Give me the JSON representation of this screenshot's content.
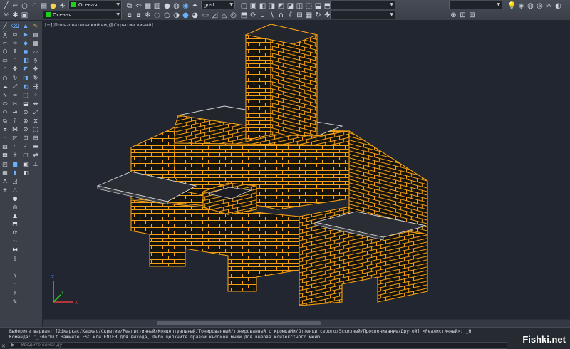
{
  "toolbar": {
    "layer_name": "Осевая",
    "style_name": "gost",
    "layer_color": "#19d319"
  },
  "viewport": {
    "label": "[−][Пользовательский вид][Скрытие линий]",
    "background": "#212630",
    "model_color": "#f5a014",
    "slab_color": "#d6d6d6"
  },
  "ucs": {
    "x_label": "X",
    "y_label": "Y",
    "z_label": "Z"
  },
  "command": {
    "line1": "Выберите вариант [2dкаркас/Каркас/Скрытие/Реалистичный/Концептуальный/Тонированный/тонированный с кромкаМи/Оттенки серого/Эскизный/Просвечивание/Другой] <Реалистичный>: _H",
    "line2": "Команда: '_3dorbit Нажмите ESC или ENTER для выхода, либо щелкните правой кнопкой мыши для вызова контекстного меню.",
    "placeholder": "Введите команду"
  },
  "watermark": "Fishki.net"
}
